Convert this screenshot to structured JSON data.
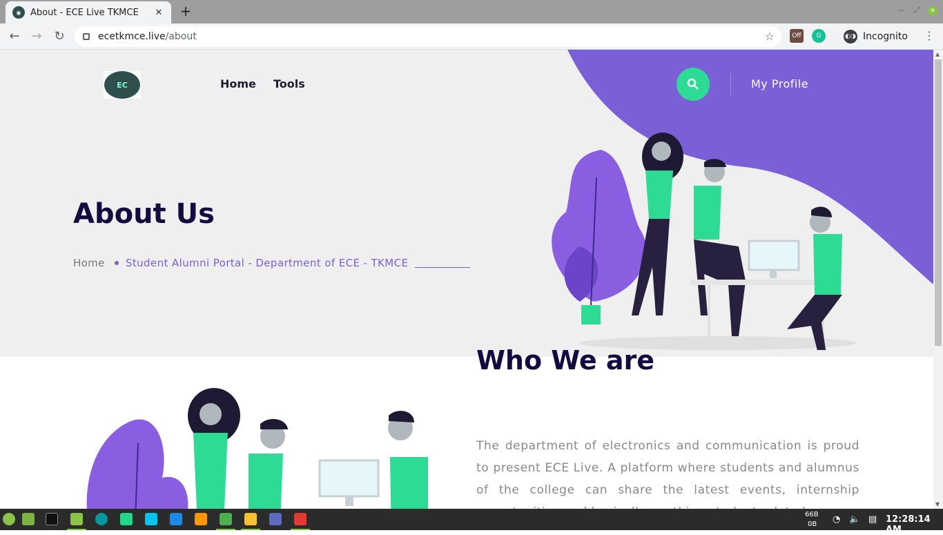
{
  "browser": {
    "tab_title": "About - ECE Live TKMCE",
    "tab_close": "✕",
    "new_tab": "+",
    "url_host": "ecetkmce.live",
    "url_path": "/about",
    "incognito_label": "Incognito",
    "ext_off_label": "Off"
  },
  "site": {
    "logo_text": "EC",
    "nav": [
      "Home",
      "Tools"
    ],
    "profile_label": "My Profile",
    "hero_title": "About Us",
    "breadcrumb_home": "Home",
    "breadcrumb_current": "Student Alumni Portal - Department of ECE - TKMCE",
    "about_title": "Who We are",
    "about_text": "The department of electronics and communication is proud to present ECE Live. A platform where students and alumnus of the college can share the latest events, internship opportunities and basically anything student related."
  },
  "taskbar": {
    "net_up": "66B",
    "net_down": "0B",
    "clock": "12:28:14 AM"
  },
  "colors": {
    "purple": "#7b5fd6",
    "green": "#2edb95",
    "navy": "#140c40"
  }
}
